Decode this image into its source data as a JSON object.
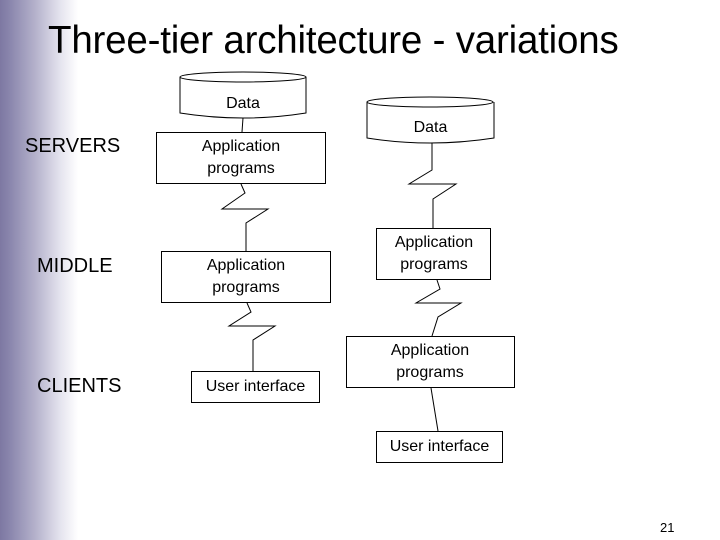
{
  "slide": {
    "title": "Three-tier architecture - variations",
    "page_number": "21",
    "accent_color": "#7d78a2"
  },
  "tiers": {
    "servers": "SERVERS",
    "middle": "MIDDLE",
    "clients": "CLIENTS"
  },
  "left_stack": {
    "data": "Data",
    "server_app": "Application programs",
    "middle_app": "Application programs",
    "client_ui": "User interface"
  },
  "right_stack": {
    "data": "Data",
    "middle_app": "Application programs",
    "client_app": "Application programs",
    "client_ui": "User interface"
  }
}
